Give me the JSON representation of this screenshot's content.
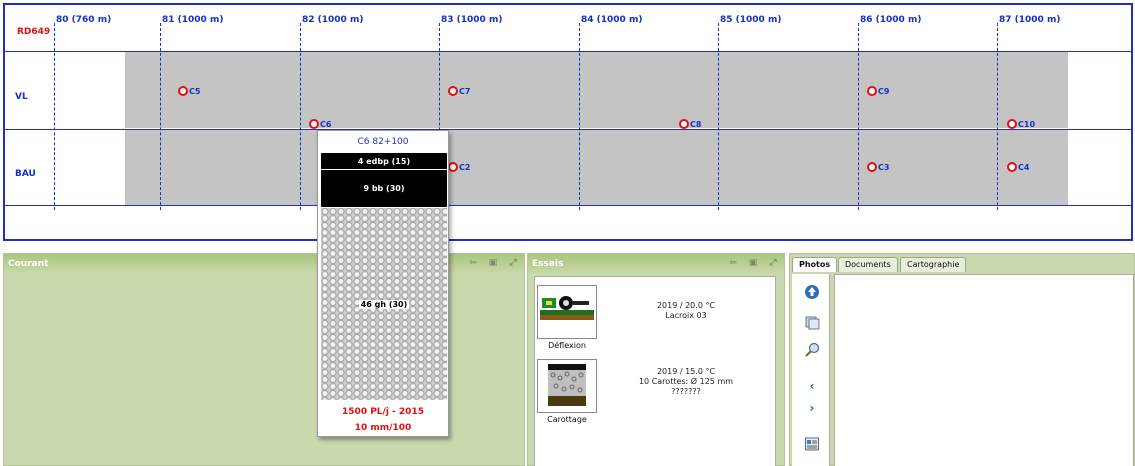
{
  "profile": {
    "road_name": "RD649",
    "km_markers": [
      "80 (760 m)",
      "81 (1000 m)",
      "82 (1000 m)",
      "83 (1000 m)",
      "84 (1000 m)",
      "85 (1000 m)",
      "86 (1000 m)",
      "87 (1000 m)"
    ],
    "lanes": [
      "VL",
      "BAU"
    ],
    "cores": [
      {
        "label": "C5",
        "lane": "VL"
      },
      {
        "label": "C7",
        "lane": "VL"
      },
      {
        "label": "C9",
        "lane": "VL"
      },
      {
        "label": "C6",
        "lane": "VL"
      },
      {
        "label": "C8",
        "lane": "VL"
      },
      {
        "label": "C10",
        "lane": "VL"
      },
      {
        "label": "C2",
        "lane": "BAU"
      },
      {
        "label": "C3",
        "lane": "BAU"
      },
      {
        "label": "C4",
        "lane": "BAU"
      }
    ],
    "colors": {
      "line": "#1d2fd0",
      "road": "#c4c4c4",
      "core": "#e01010"
    }
  },
  "popup": {
    "title": "C6  82+100",
    "layers": [
      "4 edbp (15)",
      "9 bb (30)",
      "46 gh (30)"
    ],
    "traffic": "1500 PL/j - 2015",
    "deflection": "10 mm/100"
  },
  "panels": {
    "courant": {
      "title": "Courant"
    },
    "essais": {
      "title": "Essais",
      "tests": [
        {
          "name": "Déflexion",
          "icon": "deflection-icon",
          "info": [
            "2019 / 20.0 °C",
            "Lacroix 03"
          ]
        },
        {
          "name": "Carottage",
          "icon": "core-sample-icon",
          "info": [
            "2019 / 15.0 °C",
            "10 Carottes: Ø 125 mm",
            "???????"
          ]
        }
      ]
    },
    "media": {
      "tabs": [
        "Photos",
        "Documents",
        "Cartographie"
      ],
      "active_tab": "Photos"
    }
  }
}
